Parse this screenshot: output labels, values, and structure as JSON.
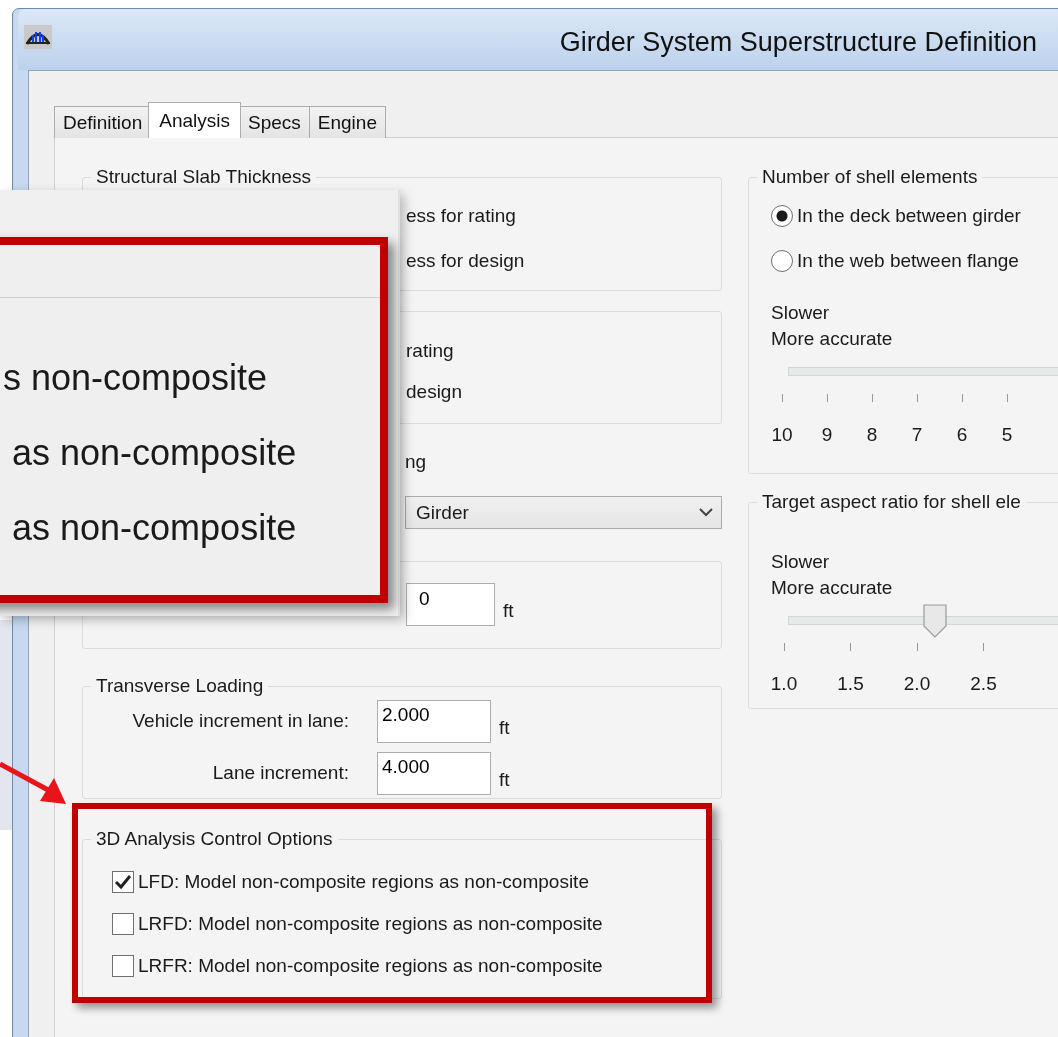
{
  "window": {
    "title": "Girder System Superstructure Definition"
  },
  "tabs": [
    {
      "label": "Definition",
      "selected": false
    },
    {
      "label": "Analysis",
      "selected": true
    },
    {
      "label": "Specs",
      "selected": false
    },
    {
      "label": "Engine",
      "selected": false
    }
  ],
  "slab_thickness": {
    "title": "Structural Slab Thickness",
    "options": [
      "ess for rating",
      "ess for design"
    ]
  },
  "group_2": {
    "options": [
      "rating",
      "design"
    ]
  },
  "group_3": {
    "label": "ng",
    "dropdown": {
      "value": "Girder"
    }
  },
  "group_4": {
    "field": {
      "value": "0"
    },
    "unit": "ft"
  },
  "transverse_loading": {
    "title": "Transverse Loading",
    "fields": [
      {
        "label": "Vehicle increment in lane:",
        "value": "2.000",
        "unit": "ft"
      },
      {
        "label": "Lane increment:",
        "value": "4.000",
        "unit": "ft"
      }
    ]
  },
  "analysis_control": {
    "title": "3D Analysis Control Options",
    "options": [
      {
        "label": "LFD: Model non-composite regions as non-composite",
        "checked": true
      },
      {
        "label": "LRFD: Model non-composite regions as non-composite",
        "checked": false
      },
      {
        "label": "LRFR: Model non-composite regions as non-composite",
        "checked": false
      }
    ]
  },
  "shell_elements": {
    "title": "Number of shell elements",
    "options": [
      {
        "label": "In the deck between girder",
        "selected": true
      },
      {
        "label": "In the web between flange",
        "selected": false
      }
    ],
    "slider": {
      "caption": [
        "Slower",
        "More accurate"
      ],
      "ticks": [
        {
          "label": "10",
          "selected": false
        },
        {
          "label": "9",
          "selected": false
        },
        {
          "label": "8",
          "selected": false
        },
        {
          "label": "7",
          "selected": false
        },
        {
          "label": "6",
          "selected": false
        },
        {
          "label": "5",
          "selected": false
        }
      ]
    }
  },
  "aspect_ratio": {
    "title": "Target aspect ratio for shell ele",
    "slider": {
      "caption": [
        "Slower",
        "More accurate"
      ],
      "ticks": [
        {
          "label": "1.0",
          "selected": false
        },
        {
          "label": "1.5",
          "selected": false
        },
        {
          "label": "2.0",
          "selected": true
        },
        {
          "label": "2.5",
          "selected": false
        }
      ]
    }
  },
  "callout": {
    "lines": [
      "s non-composite",
      "as non-composite",
      "as non-composite"
    ]
  }
}
